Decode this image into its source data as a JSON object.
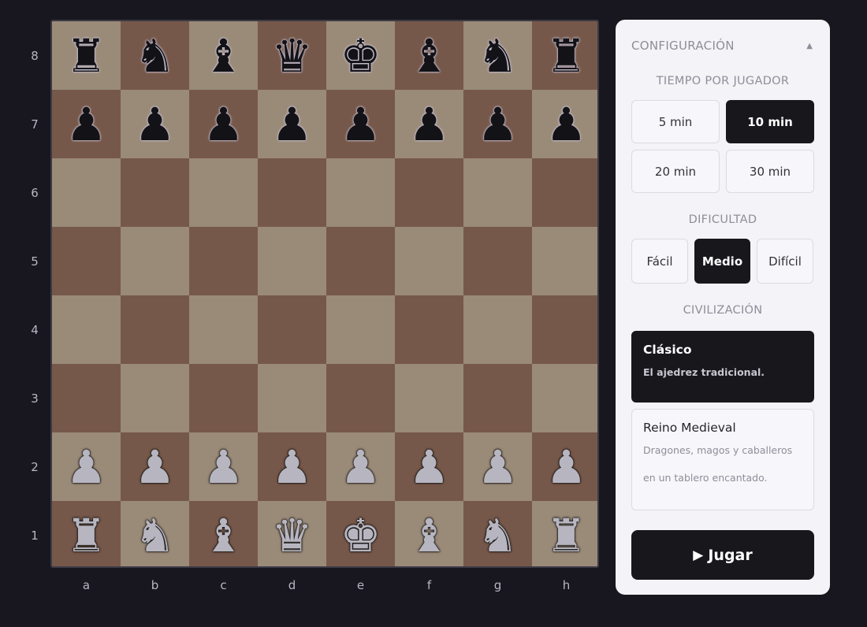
{
  "board": {
    "files": [
      "a",
      "b",
      "c",
      "d",
      "e",
      "f",
      "g",
      "h"
    ],
    "ranks": [
      "8",
      "7",
      "6",
      "5",
      "4",
      "3",
      "2",
      "1"
    ],
    "rows": [
      [
        "r",
        "n",
        "b",
        "q",
        "k",
        "b",
        "n",
        "r"
      ],
      [
        "p",
        "p",
        "p",
        "p",
        "p",
        "p",
        "p",
        "p"
      ],
      [
        "",
        "",
        "",
        "",
        "",
        "",
        "",
        ""
      ],
      [
        "",
        "",
        "",
        "",
        "",
        "",
        "",
        ""
      ],
      [
        "",
        "",
        "",
        "",
        "",
        "",
        "",
        ""
      ],
      [
        "",
        "",
        "",
        "",
        "",
        "",
        "",
        ""
      ],
      [
        "P",
        "P",
        "P",
        "P",
        "P",
        "P",
        "P",
        "P"
      ],
      [
        "R",
        "N",
        "B",
        "Q",
        "K",
        "B",
        "N",
        "R"
      ]
    ],
    "colors": {
      "light": "#9a8a78",
      "dark": "#76584a"
    }
  },
  "panel": {
    "title": "CONFIGURACIÓN",
    "collapse_icon": "chevron-up-icon",
    "time": {
      "title": "TIEMPO POR JUGADOR",
      "options": [
        "5 min",
        "10 min",
        "20 min",
        "30 min"
      ],
      "selected": "10 min"
    },
    "difficulty": {
      "title": "DIFICULTAD",
      "options": [
        "Fácil",
        "Medio",
        "Difícil"
      ],
      "selected": "Medio"
    },
    "civilization": {
      "title": "CIVILIZACIÓN",
      "options": [
        {
          "name": "Clásico",
          "desc": "El ajedrez tradicional.",
          "selected": true
        },
        {
          "name": "Reino Medieval",
          "desc": "Dragones, magos y caballeros en un tablero encantado.",
          "selected": false
        }
      ]
    },
    "play_label": "Jugar",
    "play_icon": "play-icon"
  }
}
